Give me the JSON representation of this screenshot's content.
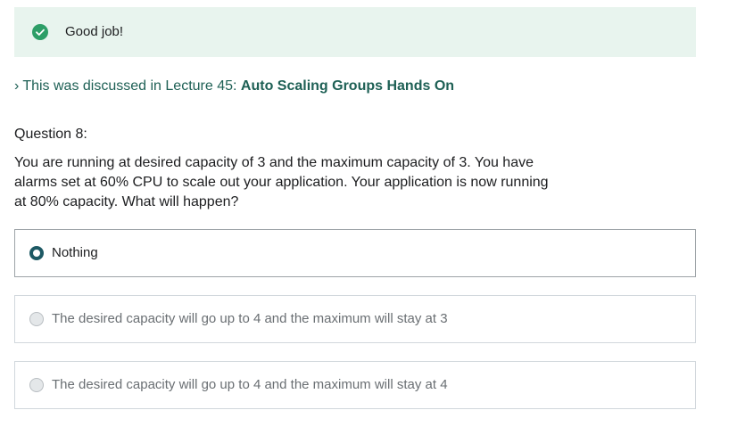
{
  "feedback": {
    "message": "Good job!",
    "icon": "check-circle-icon",
    "color": "#2d9e67",
    "background": "#e8f4ee"
  },
  "lecture_link": {
    "chevron": "›",
    "prefix": "This was discussed in Lecture 45:",
    "title": "Auto Scaling Groups Hands On"
  },
  "question": {
    "label": "Question 8:",
    "text": "You are running at desired capacity of 3 and the maximum capacity of 3. You have alarms set at 60% CPU to scale out your application. Your application is now running at 80% capacity. What will happen?"
  },
  "options": [
    {
      "label": "Nothing",
      "selected": true
    },
    {
      "label": "The desired capacity will go up to 4 and the maximum will stay at 3",
      "selected": false
    },
    {
      "label": "The desired capacity will go up to 4 and the maximum will stay at 4",
      "selected": false
    }
  ],
  "colors": {
    "link": "#1e6055",
    "radio_selected": "#1d5964",
    "border": "#d1d7dc"
  }
}
